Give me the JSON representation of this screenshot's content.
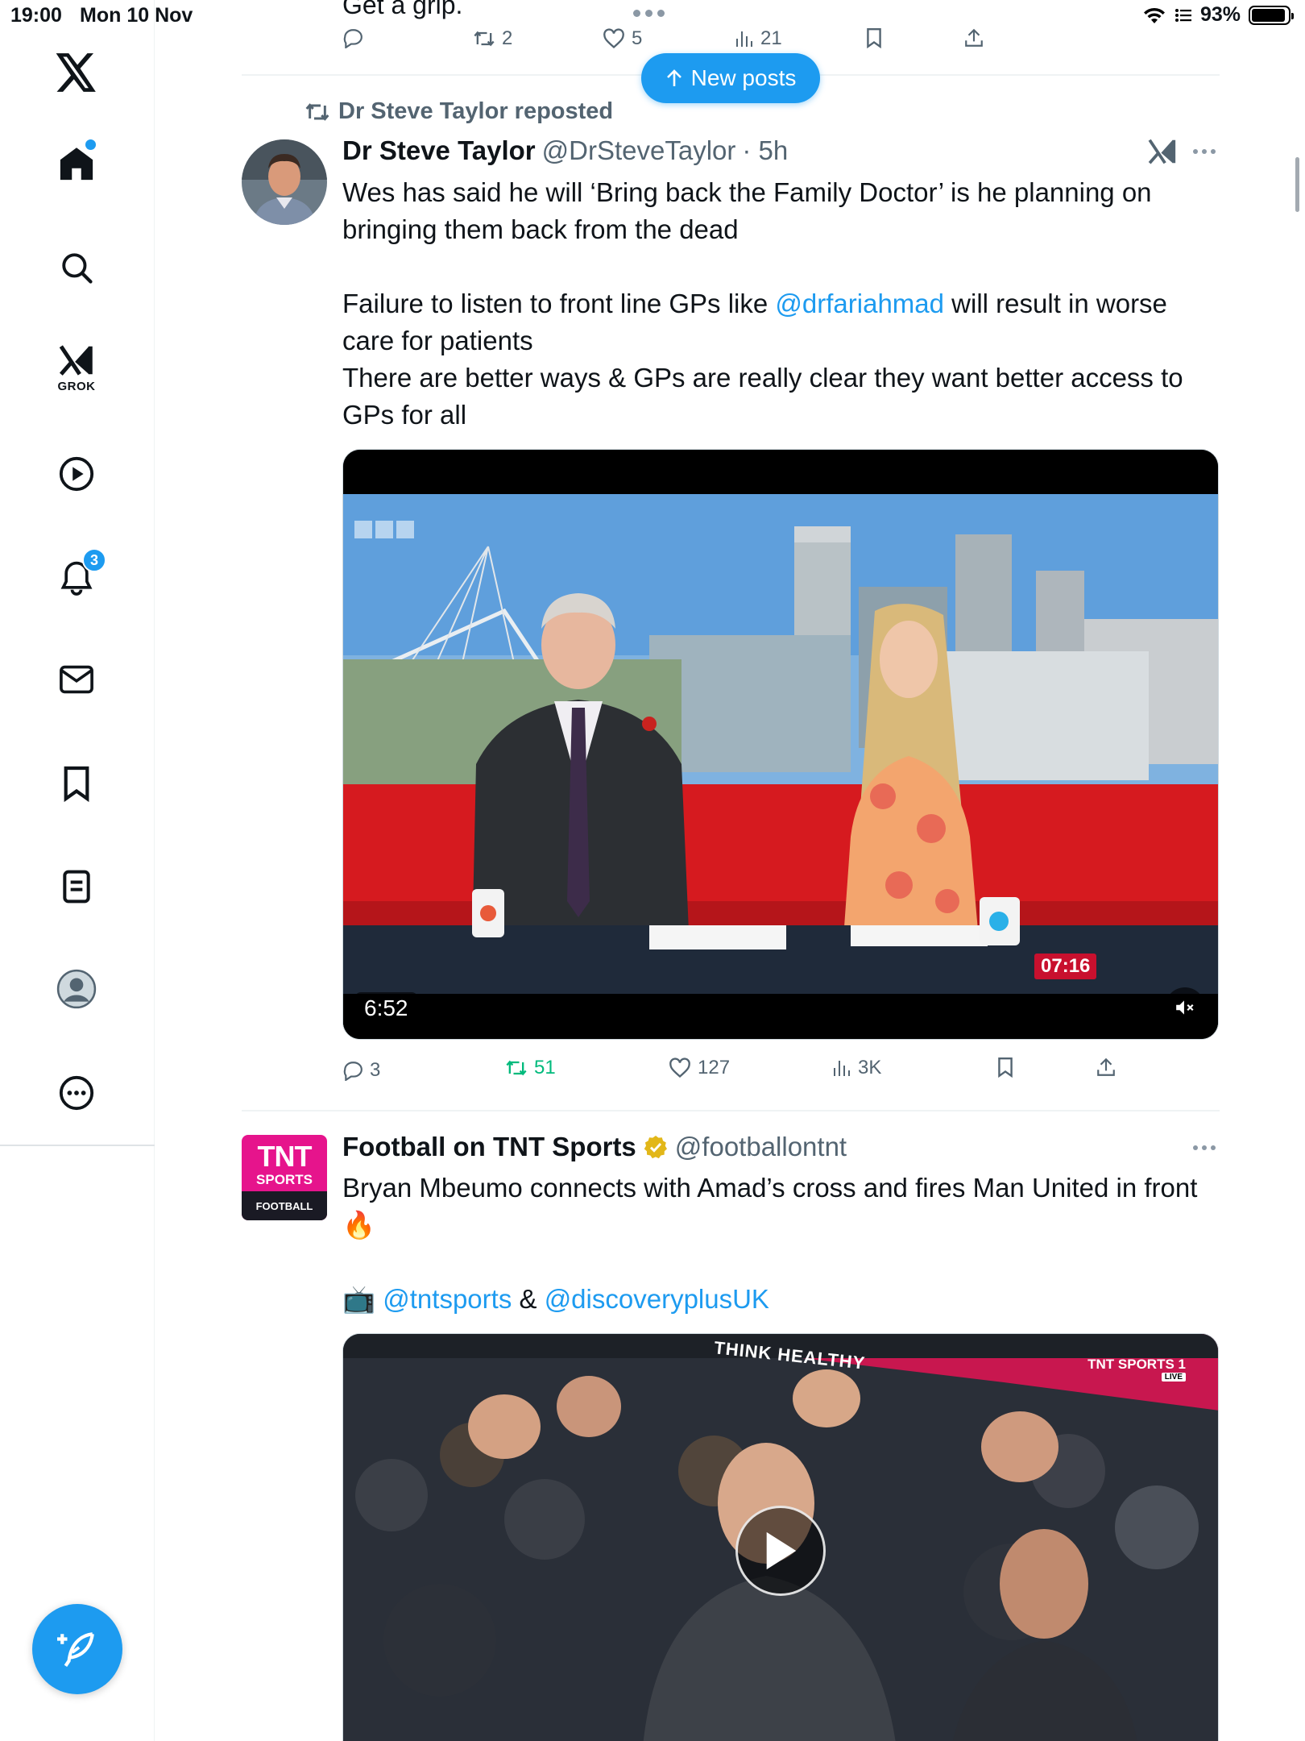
{
  "status_bar": {
    "time": "19:00",
    "date": "Mon 10 Nov",
    "battery": "93%",
    "battery_level": 0.93
  },
  "sidebar": {
    "items": [
      {
        "name": "x-logo",
        "icon": "x-logo-icon"
      },
      {
        "name": "home",
        "icon": "home-icon",
        "has_dot": true
      },
      {
        "name": "explore",
        "icon": "search-icon"
      },
      {
        "name": "grok",
        "icon": "grok-icon",
        "label": "GROK"
      },
      {
        "name": "video",
        "icon": "play-icon"
      },
      {
        "name": "notifications",
        "icon": "bell-icon",
        "badge": "3"
      },
      {
        "name": "messages",
        "icon": "mail-icon"
      },
      {
        "name": "bookmarks",
        "icon": "bookmark-icon"
      },
      {
        "name": "lists",
        "icon": "list-icon"
      },
      {
        "name": "profile",
        "icon": "avatar-icon"
      },
      {
        "name": "more",
        "icon": "more-icon"
      }
    ],
    "compose_icon": "compose-feather-icon"
  },
  "previous_post": {
    "partial_text": "Get a grip.",
    "replies": "",
    "reposts": "2",
    "likes": "5",
    "views": "21"
  },
  "new_posts_pill": "New posts",
  "tweets": [
    {
      "repost_label": "Dr Steve Taylor reposted",
      "name": "Dr Steve Taylor",
      "handle": "@DrSteveTaylor",
      "time": "· 5h",
      "body_line1": "Wes has said he will ‘Bring back the Family Doctor’ is he planning on bringing them back from the dead",
      "body_line2_pre": "Failure to listen to front line GPs like ",
      "body_line2_mention": "@drfariahmad",
      "body_line2_post": " will result in worse care for patients",
      "body_line3": "There are better ways & GPs are really clear they want better access to GPs for all",
      "video_duration": "6:52",
      "video_clock": "07:16",
      "replies": "3",
      "reposts": "51",
      "likes": "127",
      "views": "3K"
    },
    {
      "name": "Football on TNT Sports",
      "handle": "@footballontnt",
      "verified": true,
      "avatar_top": "TNT",
      "avatar_mid": "SPORTS",
      "avatar_bottom": "FOOTBALL",
      "body_line1": "Bryan Mbeumo connects with Amad’s cross and fires Man United in front 🔥",
      "body_line2_emoji": "📺",
      "body_line2_mention1": "@tntsports",
      "body_line2_amp": " & ",
      "body_line2_mention2": "@discoveryplusUK",
      "video_overlay_brand": "TNT SPORTS 1",
      "video_overlay_live": "LIVE",
      "video_banner": "THINK HEALTHY"
    }
  ],
  "colors": {
    "accent": "#1d9bf0",
    "repost_green": "#00ba7c",
    "muted_text": "#536471",
    "tnt_pink": "#e6148c"
  }
}
